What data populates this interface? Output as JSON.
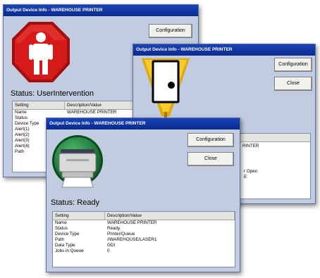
{
  "window_back": {
    "title": "Output Device Info - WAREHOUSE PRINTER",
    "configuration_label": "Configuration",
    "status_text": "Status: UserIntervention",
    "table": {
      "headers": [
        "Setting",
        "Description/Value"
      ],
      "rows": [
        [
          "Name",
          "WAREHOUSE PRINTER"
        ],
        [
          "Status",
          ""
        ],
        [
          "Device Type",
          ""
        ],
        [
          "Alert(1)",
          ""
        ],
        [
          "Alert(2)",
          ""
        ],
        [
          "Alert(3)",
          ""
        ],
        [
          "Alert(4)",
          ""
        ],
        [
          "Path",
          ""
        ]
      ]
    }
  },
  "window_middle": {
    "title": "Output Device Info - WAREHOUSE PRINTER",
    "configuration_label": "Configuration",
    "close_label": "Close",
    "table_fragments": [
      "RINTER",
      "r Open",
      "E"
    ]
  },
  "window_front": {
    "title": "Output Device Info - WAREHOUSE PRINTER",
    "configuration_label": "Configuration",
    "close_label": "Close",
    "status_text": "Status: Ready",
    "table": {
      "headers": [
        "Setting",
        "Description/Value"
      ],
      "rows": [
        [
          "Name",
          "WAREHOUSE PRINTER"
        ],
        [
          "Status",
          "Ready"
        ],
        [
          "Device Type",
          "Printer/Queue"
        ],
        [
          "Path",
          "//WAREHOUSE/LASER1"
        ],
        [
          "Data Type",
          "GDI"
        ],
        [
          "Jobs in Queue",
          "0"
        ]
      ]
    }
  },
  "colors": {
    "titlebar": "#0a2a8c",
    "window_body": "#c2cce0",
    "stop_red": "#c81414",
    "warning_yellow": "#f2c21a",
    "ready_green": "#1e7a3a"
  },
  "icons": [
    "stop-sign-person-icon",
    "warning-door-icon",
    "printer-ready-icon"
  ]
}
